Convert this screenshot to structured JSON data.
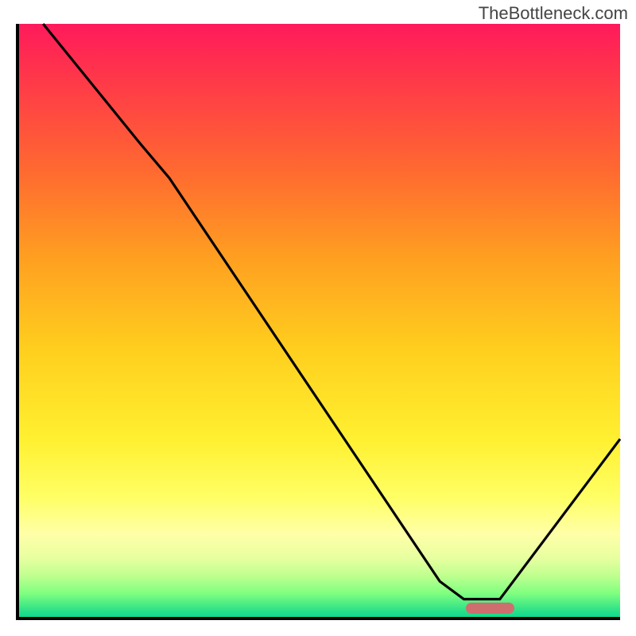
{
  "watermark": "TheBottleneck.com",
  "chart_data": {
    "type": "line",
    "title": "",
    "xlabel": "",
    "ylabel": "",
    "xlim": [
      0,
      100
    ],
    "ylim": [
      0,
      100
    ],
    "background_gradient": {
      "top": "#FF1A5B",
      "mid_upper": "#FFA120",
      "mid": "#FFFF66",
      "mid_lower": "#C0FF90",
      "bottom": "#0CDB90"
    },
    "series": [
      {
        "name": "bottleneck-curve",
        "color": "#000000",
        "x": [
          4,
          20,
          25,
          70,
          74,
          80,
          100
        ],
        "y": [
          100,
          80,
          74,
          6,
          3,
          3,
          30
        ]
      }
    ],
    "optimal_region": {
      "name": "optimal-marker",
      "color": "#CF6E6E",
      "x_start": 74,
      "x_end": 82,
      "y": 2
    },
    "grid": false,
    "legend": false
  }
}
